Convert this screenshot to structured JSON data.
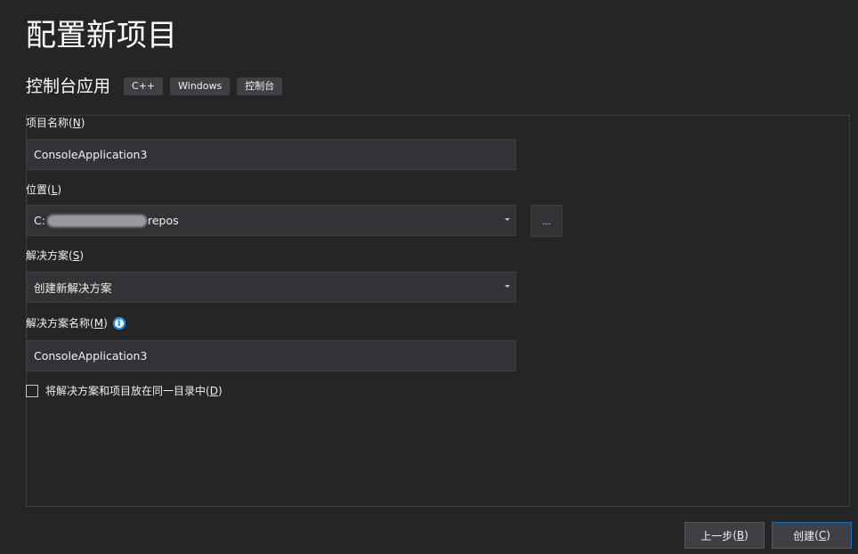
{
  "page": {
    "title": "配置新项目",
    "template_name": "控制台应用",
    "tags": [
      "C++",
      "Windows",
      "控制台"
    ]
  },
  "project_name": {
    "label": "项目名称",
    "mnemonic": "N",
    "value": "ConsoleApplication3"
  },
  "location": {
    "label": "位置",
    "mnemonic": "L",
    "value_prefix": "C:",
    "value_suffix": "repos",
    "browse_label": "..."
  },
  "solution": {
    "label": "解决方案",
    "mnemonic": "S",
    "selected": "创建新解决方案"
  },
  "solution_name": {
    "label": "解决方案名称",
    "mnemonic": "M",
    "value": "ConsoleApplication3",
    "info_glyph": "i"
  },
  "same_dir": {
    "label": "将解决方案和项目放在同一目录中",
    "mnemonic": "D",
    "checked": false
  },
  "buttons": {
    "back_label": "上一步",
    "back_mnemonic": "B",
    "create_label": "创建",
    "create_mnemonic": "C"
  },
  "colors": {
    "background": "#252526",
    "field": "#333337",
    "accent": "#0e70c0",
    "info": "#1e88e5"
  }
}
